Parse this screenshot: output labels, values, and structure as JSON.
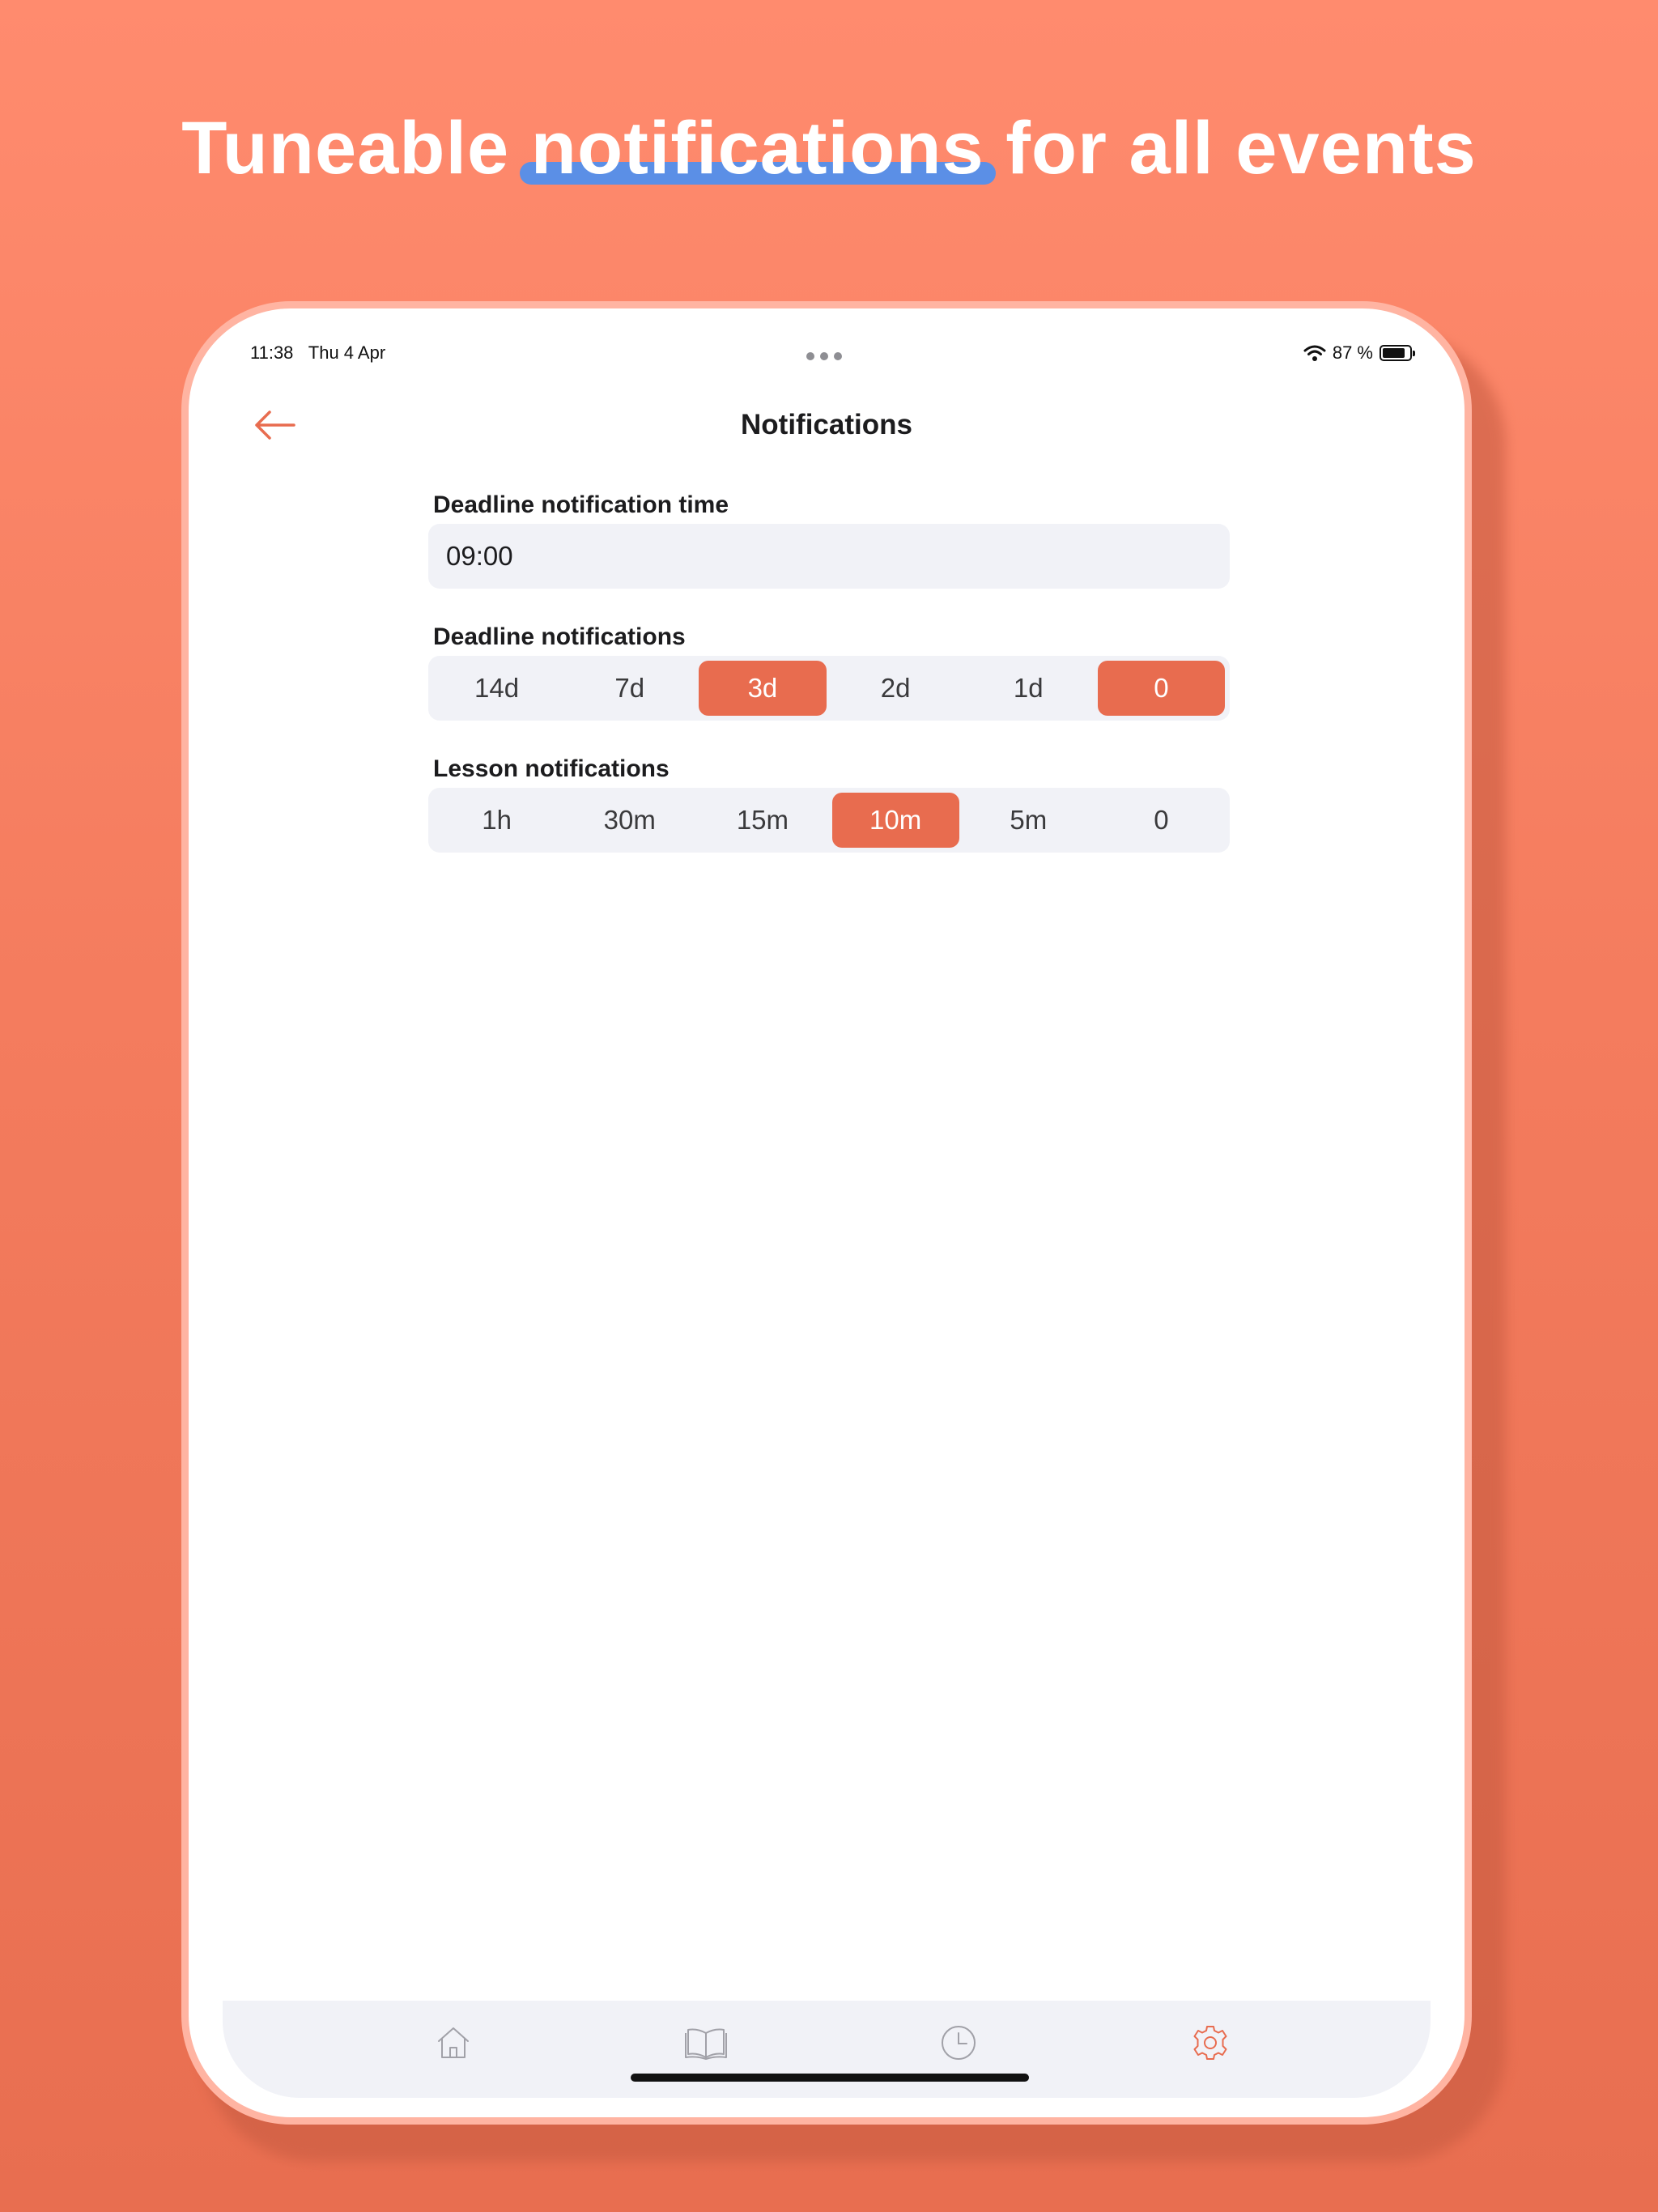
{
  "headline": {
    "before": "Tuneable",
    "highlight": "notifications",
    "after": "for all events"
  },
  "status_bar": {
    "time": "11:38",
    "date": "Thu 4 Apr",
    "battery": "87 %"
  },
  "nav": {
    "title": "Notifications",
    "back_icon": "arrow-left-icon"
  },
  "deadline_time": {
    "label": "Deadline notification time",
    "value": "09:00"
  },
  "deadline_notifications": {
    "label": "Deadline notifications",
    "options": [
      "14d",
      "7d",
      "3d",
      "2d",
      "1d",
      "0"
    ],
    "selected": [
      "3d",
      "0"
    ]
  },
  "lesson_notifications": {
    "label": "Lesson notifications",
    "options": [
      "1h",
      "30m",
      "15m",
      "10m",
      "5m",
      "0"
    ],
    "selected": [
      "10m"
    ]
  },
  "tab_bar": {
    "tabs": [
      {
        "icon": "home-icon",
        "active": false
      },
      {
        "icon": "book-icon",
        "active": false
      },
      {
        "icon": "clock-icon",
        "active": false
      },
      {
        "icon": "gear-icon",
        "active": true
      }
    ]
  },
  "colors": {
    "accent": "#E86C4F",
    "background_top": "#FF8B6E",
    "background_bottom": "#E86E50",
    "highlight_underline": "#5B8FE6",
    "segment_background": "#F1F2F7"
  }
}
